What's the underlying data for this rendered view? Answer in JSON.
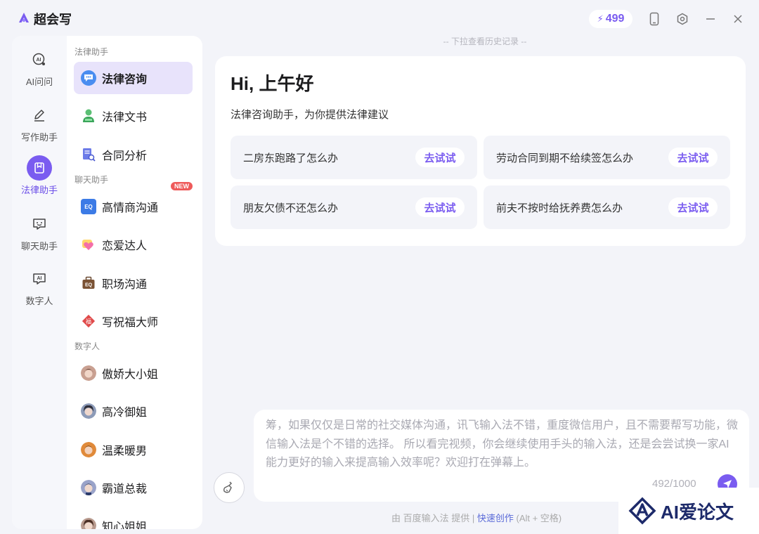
{
  "app": {
    "title": "超会写",
    "credits": "499"
  },
  "rail": {
    "items": [
      {
        "label": "AI问问"
      },
      {
        "label": "写作助手"
      },
      {
        "label": "法律助手"
      },
      {
        "label": "聊天助手"
      },
      {
        "label": "数字人"
      }
    ]
  },
  "menu": {
    "sections": {
      "legal": "法律助手",
      "chat": "聊天助手",
      "digital": "数字人"
    },
    "legal_items": [
      "法律咨询",
      "法律文书",
      "合同分析"
    ],
    "chat_items": [
      "高情商沟通",
      "恋爱达人",
      "职场沟通",
      "写祝福大师"
    ],
    "new_badge": "NEW",
    "digital_items": [
      "傲娇大小姐",
      "高冷御姐",
      "温柔暖男",
      "霸道总裁",
      "知心姐姐"
    ]
  },
  "main": {
    "history_hint": "-- 下拉查看历史记录 --",
    "greeting": "Hi, 上午好",
    "subtitle": "法律咨询助手，为你提供法律建议",
    "suggestions": [
      "二房东跑路了怎么办",
      "劳动合同到期不给续签怎么办",
      "朋友欠债不还怎么办",
      "前夫不按时给抚养费怎么办"
    ],
    "try_label": "去试试"
  },
  "input": {
    "text": "筹，如果仅仅是日常的社交媒体沟通，讯飞输入法不错，重度微信用户，且不需要帮写功能，微信输入法是个不错的选择。 所以看完视频，你会继续使用手头的输入法，还是会尝试换一家AI能力更好的输入来提高输入效率呢？欢迎打在弹幕上。",
    "char_count": "492/1000"
  },
  "footer": {
    "provided_by": "由 百度输入法 提供 |",
    "link": "快速创作",
    "shortcut": "(Alt + 空格)"
  },
  "watermark": {
    "text": "AI爱论文"
  },
  "colors": {
    "accent": "#7a5cf0",
    "accent_light": "#e8e3fb",
    "badge_red": "#ee5a5a"
  }
}
